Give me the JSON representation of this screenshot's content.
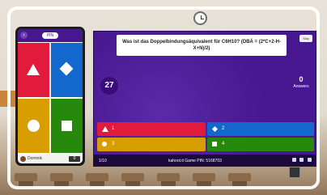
{
  "question": {
    "text": "Was ist das Doppelbindungsäquivalent für C6H10? (DBÄ = (2*C+2-H-X+N)/2)"
  },
  "skip_label": "Skip",
  "timer": {
    "value": "27"
  },
  "answers_count": {
    "value": "0",
    "label": "Answers"
  },
  "answers": [
    {
      "label": "1",
      "color": "#e21b3c",
      "shape": "triangle-icon"
    },
    {
      "label": "2",
      "color": "#1368ce",
      "shape": "diamond-icon"
    },
    {
      "label": "3",
      "color": "#d89e00",
      "shape": "circle-icon"
    },
    {
      "label": "4",
      "color": "#26890c",
      "shape": "square-icon"
    }
  ],
  "footer": {
    "progress": "1/10",
    "game_info": "kahoot.it  Game PIN: 5168703"
  },
  "phone": {
    "pin_pill": "PIN",
    "player_name": "Dominik",
    "score": "0"
  },
  "colors": {
    "kahoot_purple": "#46178f",
    "red": "#e21b3c",
    "blue": "#1368ce",
    "yellow": "#d89e00",
    "green": "#26890c"
  }
}
